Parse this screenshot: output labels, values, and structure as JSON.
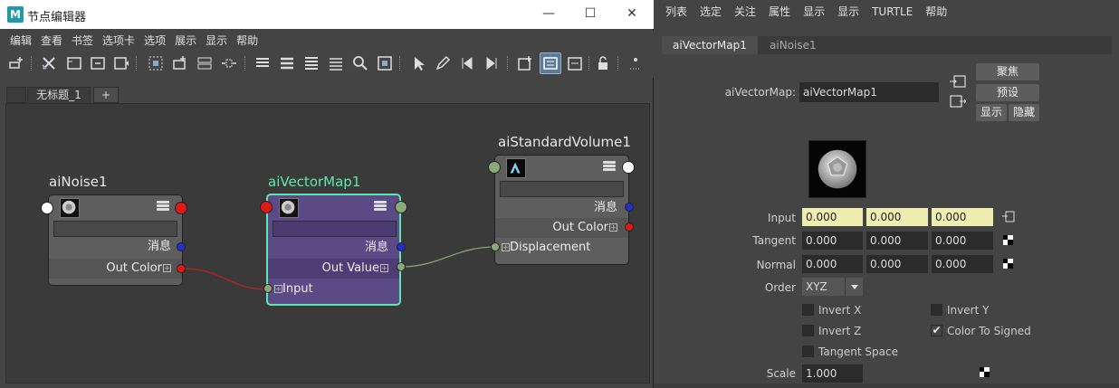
{
  "window": {
    "title": "节点编辑器",
    "app_logo": "M",
    "controls": {
      "minimize": "—",
      "maximize": "☐",
      "close": "✕"
    }
  },
  "menubar": [
    "编辑",
    "查看",
    "书签",
    "选项卡",
    "选项",
    "展示",
    "显示",
    "帮助"
  ],
  "toolbar_icons": [
    "add-selected-icon",
    "remove-icon",
    "frame-all-icon",
    "frame-selected-icon",
    "frame-next-icon",
    "graph-in-icon",
    "graph-out-icon",
    "graph-inout-icon",
    "graph-spread-icon",
    "layout-simple-icon",
    "layout-connected-icon",
    "layout-all-icon",
    "layout-custom-icon",
    "search-icon",
    "snapshot-icon",
    "pin-icon",
    "edit-icon",
    "back-icon",
    "forward-icon",
    "toggle-swatch-icon",
    "toggle-attr-icon",
    "toggle-filter-icon",
    "lock-icon",
    "more-icon"
  ],
  "editor_tabs": {
    "main": "无标题_1",
    "add": "+"
  },
  "nodes": {
    "noise": {
      "name": "aiNoise1",
      "message": "消息",
      "out": "Out Color"
    },
    "vector": {
      "name": "aiVectorMap1",
      "message": "消息",
      "out": "Out Value",
      "in": "Input"
    },
    "volume": {
      "name": "aiStandardVolume1",
      "message": "消息",
      "out": "Out Color",
      "in": "Displacement"
    }
  },
  "colors": {
    "selected_border": "#5ee6b0",
    "selected_fill": "#5a4a86",
    "port_red": "#e01818",
    "port_blue": "#2030d0",
    "port_green": "#88aa77",
    "connection": "#8aa070",
    "connection_red": "#c02020"
  },
  "ae": {
    "menubar": [
      "列表",
      "选定",
      "关注",
      "属性",
      "显示",
      "显示",
      "TURTLE",
      "帮助"
    ],
    "tabs": [
      "aiVectorMap1",
      "aiNoise1"
    ],
    "node_type_label": "aiVectorMap:",
    "node_name": "aiVectorMap1",
    "buttons": {
      "focus": "聚焦",
      "presets": "预设",
      "show": "显示",
      "hide": "隐藏"
    },
    "attrs": {
      "input": {
        "label": "Input",
        "values": [
          "0.000",
          "0.000",
          "0.000"
        ]
      },
      "tangent": {
        "label": "Tangent",
        "values": [
          "0.000",
          "0.000",
          "0.000"
        ]
      },
      "normal": {
        "label": "Normal",
        "values": [
          "0.000",
          "0.000",
          "0.000"
        ]
      },
      "order": {
        "label": "Order",
        "value": "XYZ"
      },
      "scale": {
        "label": "Scale",
        "value": "1.000"
      }
    },
    "checkboxes": {
      "invert_x": {
        "label": "Invert X",
        "checked": false
      },
      "invert_y": {
        "label": "Invert Y",
        "checked": false
      },
      "invert_z": {
        "label": "Invert Z",
        "checked": false
      },
      "color_to_signed": {
        "label": "Color To Signed",
        "checked": true
      },
      "tangent_space": {
        "label": "Tangent Space",
        "checked": false
      }
    },
    "check_mark": "✔"
  }
}
